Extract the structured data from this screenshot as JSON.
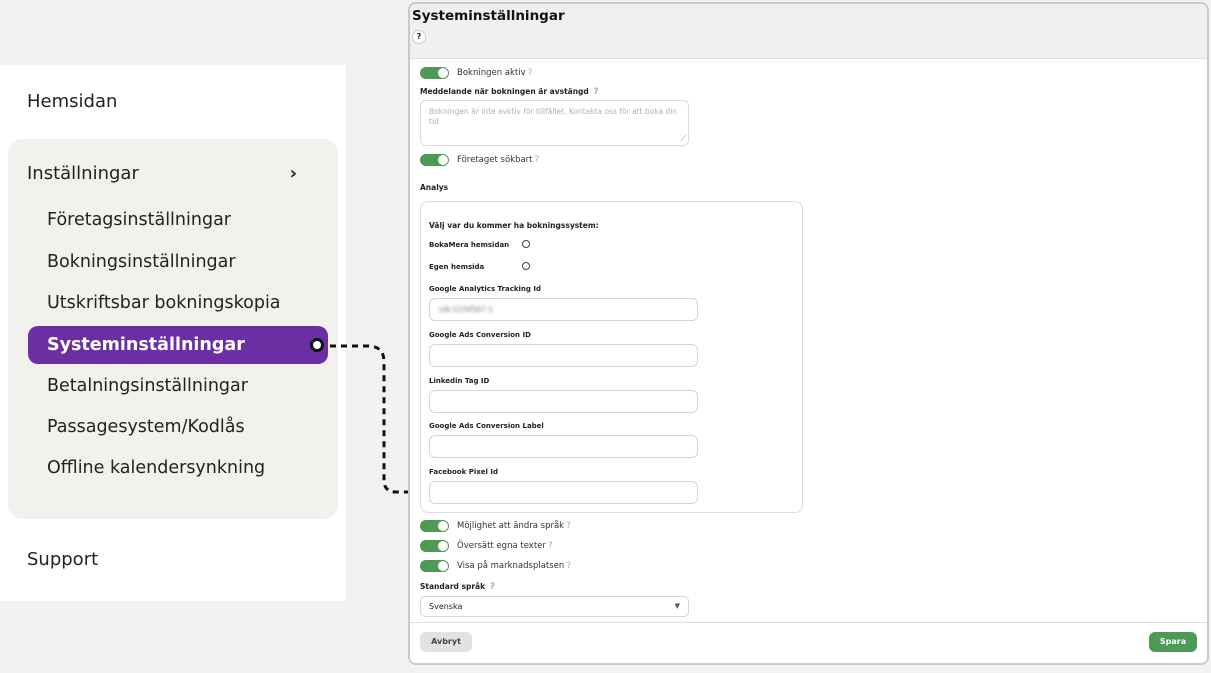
{
  "sidebar": {
    "home": "Hemsidan",
    "settings_header": "Inställningar",
    "chevron": "›",
    "items": [
      {
        "label": "Företagsinställningar"
      },
      {
        "label": "Bokningsinställningar"
      },
      {
        "label": "Utskriftsbar bokningskopia"
      },
      {
        "label": "Systeminställningar",
        "active": true
      },
      {
        "label": "Betalningsinställningar"
      },
      {
        "label": "Passagesystem/Kodlås"
      },
      {
        "label": "Offline kalendersynkning"
      }
    ],
    "support": "Support"
  },
  "panel": {
    "title": "Systeminställningar",
    "help": "?",
    "booking_active": {
      "label": "Bokningen aktiv",
      "on": true
    },
    "closed_message": {
      "label": "Meddelande när bokningen är avstängd",
      "placeholder": "Bokningen är inte avktiv för tillfället. Kontakta oss för att boka din tid"
    },
    "searchable": {
      "label": "Företaget sökbart",
      "on": true
    },
    "analys": {
      "heading": "Analys",
      "choose_label": "Välj var du kommer ha bokningssystem:",
      "options": [
        {
          "label": "BokaMera hemsidan",
          "selected": false
        },
        {
          "label": "Egen hemsida",
          "selected": false
        }
      ],
      "fields": [
        {
          "label": "Google Analytics Tracking Id",
          "value": "UA-1234567-1"
        },
        {
          "label": "Google Ads Conversion ID",
          "value": ""
        },
        {
          "label": "Linkedin Tag ID",
          "value": ""
        },
        {
          "label": "Google Ads Conversion Label",
          "value": ""
        },
        {
          "label": "Facebook Pixel Id",
          "value": ""
        }
      ]
    },
    "language_change": {
      "label": "Möjlighet att ändra språk",
      "on": true
    },
    "translate_texts": {
      "label": "Översätt egna texter",
      "on": true
    },
    "marketplace": {
      "label": "Visa på marknadsplatsen",
      "on": true
    },
    "default_language": {
      "label": "Standard språk",
      "value": "Svenska"
    },
    "cancel_button": "Avbryt",
    "save_button": "Spara"
  },
  "colors": {
    "accent": "#6b2fa3",
    "toggle_on": "#4c9a55",
    "save": "#4c9a55"
  }
}
